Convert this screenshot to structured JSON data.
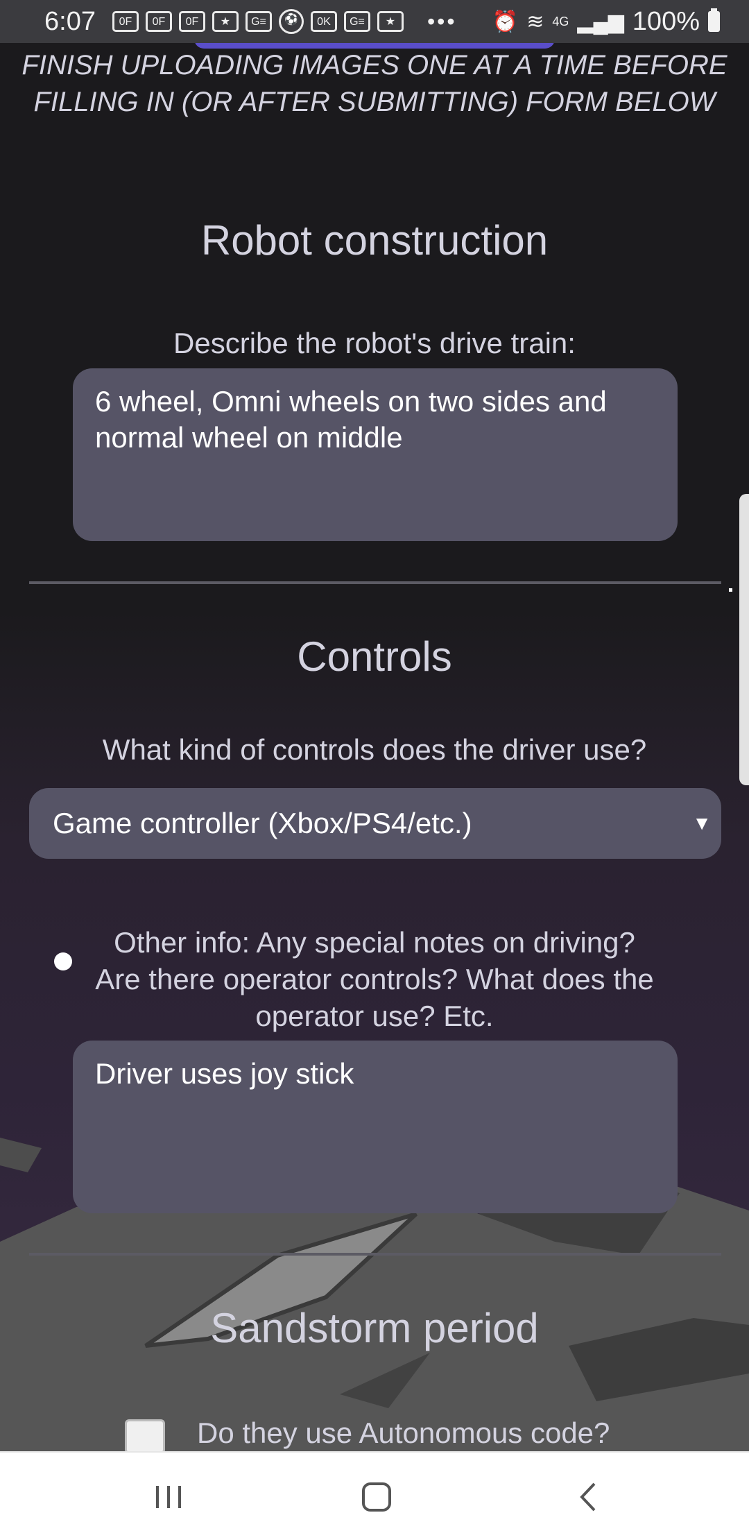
{
  "status_bar": {
    "time": "6:07",
    "network": "4G",
    "battery": "100%",
    "notification_icons": [
      "of",
      "of",
      "of",
      "nfl",
      "ge",
      "sport",
      "ok",
      "ge",
      "nfl"
    ]
  },
  "notice": {
    "text": "FINISH UPLOADING IMAGES ONE AT A TIME BEFORE FILLING IN (OR AFTER SUBMITTING) FORM BELOW"
  },
  "robot_construction": {
    "heading": "Robot construction",
    "drive_train_label": "Describe the robot's drive train:",
    "drive_train_value": "6 wheel, Omni wheels on two sides and normal wheel on middle"
  },
  "controls": {
    "heading": "Controls",
    "question": "What kind of controls does the driver use?",
    "selected": "Game controller (Xbox/PS4/etc.)",
    "other_info_label": "Other info: Any special notes on driving? Are there operator controls? What does the operator use? Etc.",
    "other_info_value": "Driver uses joy stick"
  },
  "sandstorm": {
    "heading": "Sandstorm period",
    "autonomous_label": "Do they use Autonomous code?",
    "autonomous_checked": false
  },
  "colors": {
    "background": "#1b1a1d",
    "field": "#565466",
    "text": "#d4d3e0",
    "accent": "#5a4ec9"
  },
  "nav_bar": {
    "icons": [
      "recent-apps-icon",
      "home-icon",
      "back-icon"
    ]
  }
}
